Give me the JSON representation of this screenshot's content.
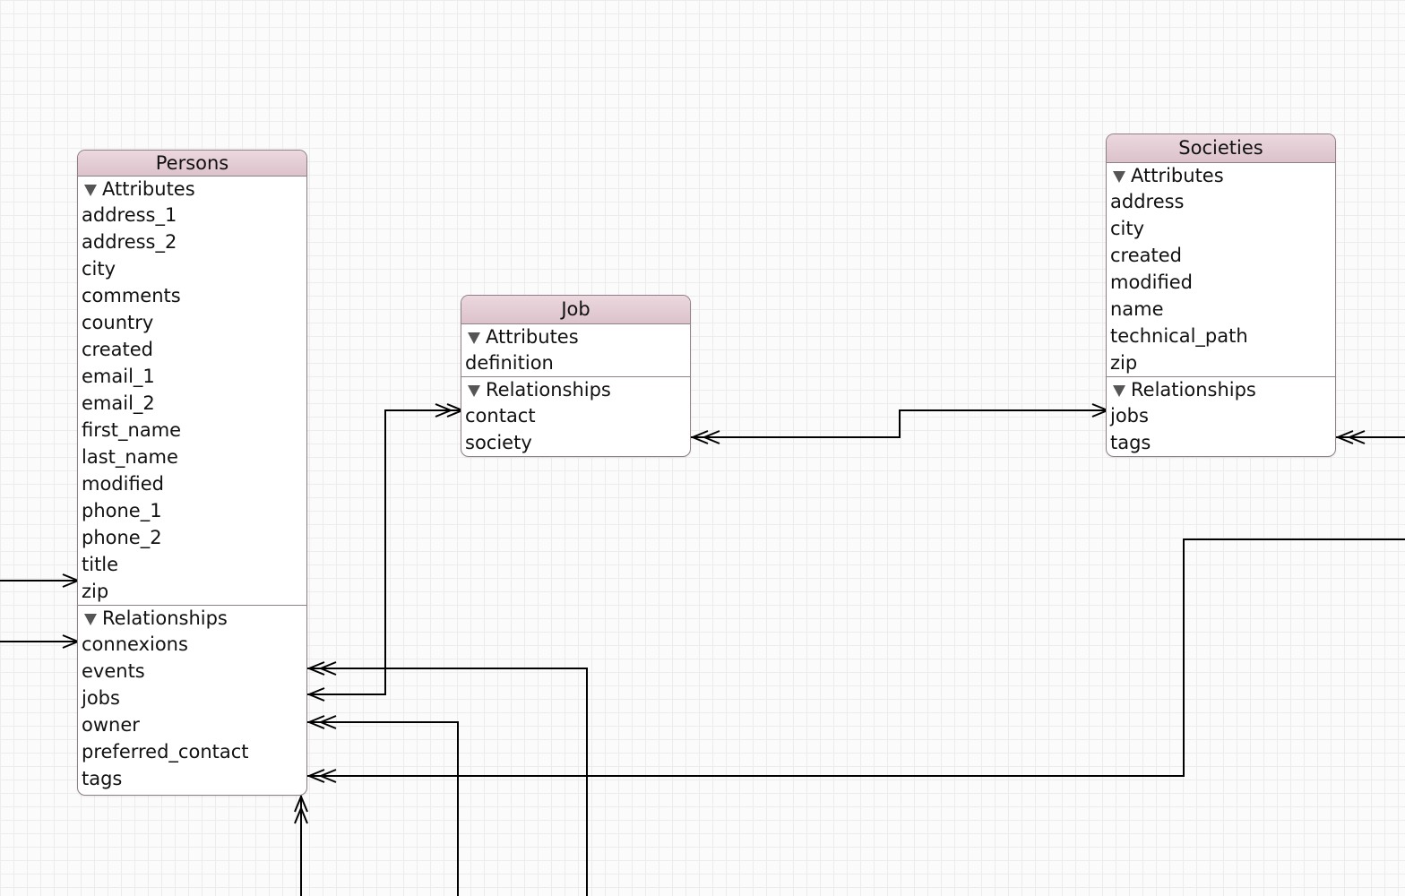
{
  "colors": {
    "header_fill": "#dcc2cb",
    "border": "#8f7f86",
    "grid": "#ececec",
    "connector": "#000000"
  },
  "entities": [
    {
      "name": "Persons",
      "attributes_label": "Attributes",
      "attributes": [
        "address_1",
        "address_2",
        "city",
        "comments",
        "country",
        "created",
        "email_1",
        "email_2",
        "first_name",
        "last_name",
        "modified",
        "phone_1",
        "phone_2",
        "title",
        "zip"
      ],
      "relationships_label": "Relationships",
      "relationships": [
        "connexions",
        "events",
        "jobs",
        "owner",
        "preferred_contact",
        "tags"
      ]
    },
    {
      "name": "Job",
      "attributes_label": "Attributes",
      "attributes": [
        "definition"
      ],
      "relationships_label": "Relationships",
      "relationships": [
        "contact",
        "society"
      ]
    },
    {
      "name": "Societies",
      "attributes_label": "Attributes",
      "attributes": [
        "address",
        "city",
        "created",
        "modified",
        "name",
        "technical_path",
        "zip"
      ],
      "relationships_label": "Relationships",
      "relationships": [
        "jobs",
        "tags"
      ]
    }
  ]
}
